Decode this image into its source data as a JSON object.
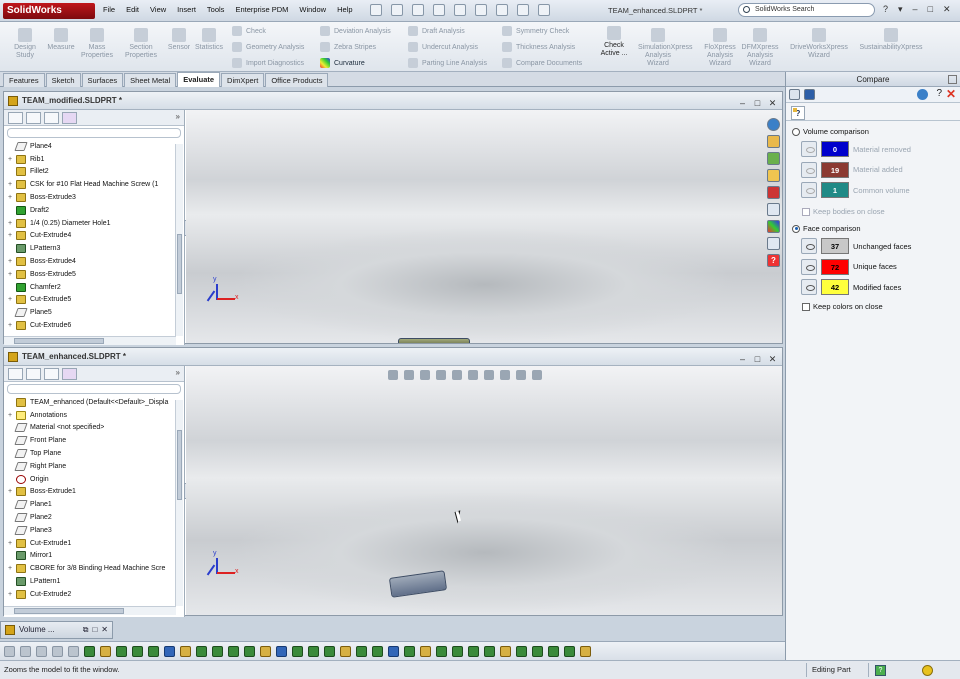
{
  "app": {
    "logo_text": "SolidWorks",
    "menus": [
      "File",
      "Edit",
      "View",
      "Insert",
      "Tools",
      "Enterprise PDM",
      "Window",
      "Help"
    ],
    "title": "TEAM_enhanced.SLDPRT *",
    "search_placeholder": "SolidWorks Search",
    "help_buttons": [
      "?",
      "▾",
      "–",
      "□",
      "✕"
    ]
  },
  "ribbon": {
    "large_buttons": [
      {
        "label": "Design Study",
        "icon": "design-study-icon"
      },
      {
        "label": "Measure",
        "icon": "measure-icon"
      },
      {
        "label": "Mass Properties",
        "icon": "mass-properties-icon"
      },
      {
        "label": "Section Properties",
        "icon": "section-properties-icon"
      },
      {
        "label": "Sensor",
        "icon": "sensor-icon"
      },
      {
        "label": "Statistics",
        "icon": "statistics-icon"
      }
    ],
    "small_buttons": [
      {
        "label": "Check",
        "icon": "check-icon"
      },
      {
        "label": "Geometry Analysis",
        "icon": "geometry-analysis-icon"
      },
      {
        "label": "Import Diagnostics",
        "icon": "import-diagnostics-icon"
      },
      {
        "label": "Deviation Analysis",
        "icon": "deviation-analysis-icon"
      },
      {
        "label": "Zebra Stripes",
        "icon": "zebra-stripes-icon"
      },
      {
        "label": "Curvature",
        "icon": "curvature-icon",
        "active": true
      },
      {
        "label": "Draft Analysis",
        "icon": "draft-analysis-icon"
      },
      {
        "label": "Undercut Analysis",
        "icon": "undercut-analysis-icon"
      },
      {
        "label": "Parting Line Analysis",
        "icon": "parting-line-icon"
      },
      {
        "label": "Symmetry Check",
        "icon": "symmetry-check-icon"
      },
      {
        "label": "Thickness Analysis",
        "icon": "thickness-analysis-icon"
      },
      {
        "label": "Compare Documents",
        "icon": "compare-documents-icon"
      }
    ],
    "check_active": "Check Active ...",
    "xpress_buttons": [
      {
        "label": "SimulationXpress Analysis Wizard"
      },
      {
        "label": "FloXpress Analysis Wizard"
      },
      {
        "label": "DFMXpress Analysis Wizard"
      },
      {
        "label": "DriveWorksXpress Wizard"
      },
      {
        "label": "SustainabilityXpress"
      }
    ]
  },
  "command_tabs": [
    {
      "label": "Features"
    },
    {
      "label": "Sketch"
    },
    {
      "label": "Surfaces"
    },
    {
      "label": "Sheet Metal"
    },
    {
      "label": "Evaluate",
      "active": true
    },
    {
      "label": "DimXpert"
    },
    {
      "label": "Office Products"
    }
  ],
  "doc_top": {
    "title": "TEAM_modified.SLDPRT *",
    "tree": [
      {
        "label": "Plane4",
        "type": "plane",
        "expand": ""
      },
      {
        "label": "Rib1",
        "type": "feature",
        "expand": "+"
      },
      {
        "label": "Fillet2",
        "type": "feature",
        "expand": ""
      },
      {
        "label": "CSK for #10 Flat Head Machine Screw (1",
        "type": "feature",
        "expand": "+"
      },
      {
        "label": "Boss-Extrude3",
        "type": "feature",
        "expand": "+"
      },
      {
        "label": "Draft2",
        "type": "green",
        "expand": ""
      },
      {
        "label": "1/4 (0.25) Diameter Hole1",
        "type": "feature",
        "expand": "+"
      },
      {
        "label": "Cut-Extrude4",
        "type": "feature",
        "expand": "+"
      },
      {
        "label": "LPattern3",
        "type": "pattern",
        "expand": ""
      },
      {
        "label": "Boss-Extrude4",
        "type": "feature",
        "expand": "+"
      },
      {
        "label": "Boss-Extrude5",
        "type": "feature",
        "expand": "+"
      },
      {
        "label": "Chamfer2",
        "type": "green",
        "expand": ""
      },
      {
        "label": "Cut-Extrude5",
        "type": "feature",
        "expand": "+"
      },
      {
        "label": "Plane5",
        "type": "plane",
        "expand": ""
      },
      {
        "label": "Cut-Extrude6",
        "type": "feature",
        "expand": "+"
      }
    ]
  },
  "doc_bottom": {
    "title": "TEAM_enhanced.SLDPRT *",
    "tree": [
      {
        "label": "TEAM_enhanced  (Default<<Default>_Displa",
        "type": "feature",
        "expand": ""
      },
      {
        "label": "Annotations",
        "type": "note",
        "expand": "+"
      },
      {
        "label": "Material <not specified>",
        "type": "plane",
        "expand": ""
      },
      {
        "label": "Front Plane",
        "type": "plane",
        "expand": ""
      },
      {
        "label": "Top Plane",
        "type": "plane",
        "expand": ""
      },
      {
        "label": "Right Plane",
        "type": "plane",
        "expand": ""
      },
      {
        "label": "Origin",
        "type": "origin",
        "expand": ""
      },
      {
        "label": "Boss-Extrude1",
        "type": "feature",
        "expand": "+"
      },
      {
        "label": "Plane1",
        "type": "plane",
        "expand": ""
      },
      {
        "label": "Plane2",
        "type": "plane",
        "expand": ""
      },
      {
        "label": "Plane3",
        "type": "plane",
        "expand": ""
      },
      {
        "label": "Cut-Extrude1",
        "type": "feature",
        "expand": "+"
      },
      {
        "label": "Mirror1",
        "type": "pattern",
        "expand": ""
      },
      {
        "label": "CBORE for 3/8 Binding Head Machine Scre",
        "type": "feature",
        "expand": "+"
      },
      {
        "label": "LPattern1",
        "type": "pattern",
        "expand": ""
      },
      {
        "label": "Cut-Extrude2",
        "type": "feature",
        "expand": "+"
      }
    ]
  },
  "compare": {
    "title": "Compare",
    "help_tab": "?",
    "volume": {
      "label": "Volume comparison",
      "selected": false,
      "rows": [
        {
          "value": "0",
          "label": "Material removed",
          "color": "#0000cc",
          "text_color": "#ffffff"
        },
        {
          "value": "19",
          "label": "Material added",
          "color": "#8b3a32",
          "text_color": "#ffffff"
        },
        {
          "value": "1",
          "label": "Common volume",
          "color": "#1f8a86",
          "text_color": "#ffffff"
        }
      ],
      "keep_label": "Keep bodies on close"
    },
    "face": {
      "label": "Face comparison",
      "selected": true,
      "rows": [
        {
          "value": "37",
          "label": "Unchanged faces",
          "color": "#c8c8c8",
          "text_color": "#000000"
        },
        {
          "value": "72",
          "label": "Unique faces",
          "color": "#ff0000",
          "text_color": "#000000"
        },
        {
          "value": "42",
          "label": "Modified faces",
          "color": "#ffff3c",
          "text_color": "#000000"
        }
      ],
      "keep_label": "Keep colors on close"
    }
  },
  "minimized_tab": {
    "label": "Volume ..."
  },
  "status": {
    "message": "Zooms the model to fit the window.",
    "mode": "Editing Part"
  },
  "viewport": {
    "triad_x": "x",
    "triad_y": "y"
  }
}
